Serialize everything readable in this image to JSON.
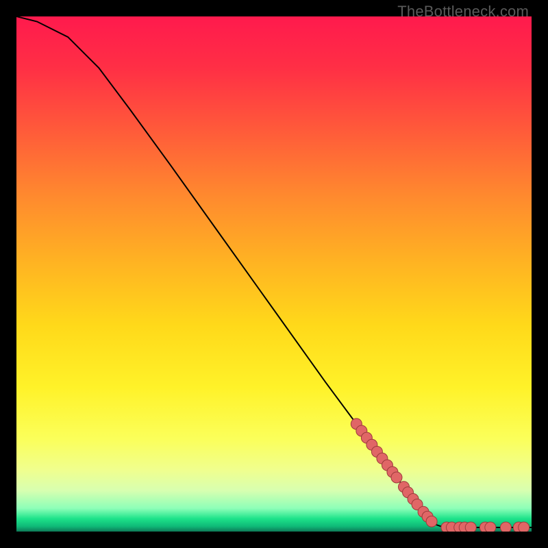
{
  "attribution": "TheBottleneck.com",
  "chart_data": {
    "type": "line",
    "title": "",
    "xlabel": "",
    "ylabel": "",
    "xlim": [
      0,
      100
    ],
    "ylim": [
      0,
      100
    ],
    "curve": [
      {
        "x": 0,
        "y": 100
      },
      {
        "x": 4,
        "y": 99
      },
      {
        "x": 10,
        "y": 96
      },
      {
        "x": 16,
        "y": 90
      },
      {
        "x": 22,
        "y": 82
      },
      {
        "x": 30,
        "y": 71
      },
      {
        "x": 40,
        "y": 57
      },
      {
        "x": 50,
        "y": 43
      },
      {
        "x": 60,
        "y": 29
      },
      {
        "x": 70,
        "y": 15.5
      },
      {
        "x": 78,
        "y": 5
      },
      {
        "x": 81,
        "y": 1.5
      },
      {
        "x": 83,
        "y": 0.8
      },
      {
        "x": 100,
        "y": 0.8
      }
    ],
    "markers_on_curve": [
      {
        "x": 66,
        "y": 20.9
      },
      {
        "x": 67,
        "y": 19.55
      },
      {
        "x": 68,
        "y": 18.2
      },
      {
        "x": 69,
        "y": 16.85
      },
      {
        "x": 70,
        "y": 15.5
      },
      {
        "x": 71,
        "y": 14.19
      },
      {
        "x": 72,
        "y": 12.88
      },
      {
        "x": 73,
        "y": 11.56
      },
      {
        "x": 73.8,
        "y": 10.51
      },
      {
        "x": 75.2,
        "y": 8.68
      },
      {
        "x": 76,
        "y": 7.62
      },
      {
        "x": 77,
        "y": 6.31
      },
      {
        "x": 77.8,
        "y": 5.26
      },
      {
        "x": 79,
        "y": 3.83
      },
      {
        "x": 79.8,
        "y": 2.9
      },
      {
        "x": 80.6,
        "y": 1.97
      }
    ],
    "markers_flat": [
      {
        "x": 83.5,
        "y": 0.8
      },
      {
        "x": 84.5,
        "y": 0.8
      },
      {
        "x": 86,
        "y": 0.8
      },
      {
        "x": 87,
        "y": 0.8
      },
      {
        "x": 88.2,
        "y": 0.8
      },
      {
        "x": 91,
        "y": 0.8
      },
      {
        "x": 92,
        "y": 0.8
      },
      {
        "x": 95,
        "y": 0.8
      },
      {
        "x": 97.5,
        "y": 0.8
      },
      {
        "x": 98.5,
        "y": 0.8
      }
    ],
    "gradient_stops": [
      {
        "offset": 0.0,
        "color": "#ff1a4d"
      },
      {
        "offset": 0.1,
        "color": "#ff2f45"
      },
      {
        "offset": 0.22,
        "color": "#ff5a3a"
      },
      {
        "offset": 0.35,
        "color": "#ff8a2e"
      },
      {
        "offset": 0.48,
        "color": "#ffb422"
      },
      {
        "offset": 0.6,
        "color": "#ffd91a"
      },
      {
        "offset": 0.72,
        "color": "#fff229"
      },
      {
        "offset": 0.82,
        "color": "#fbff5a"
      },
      {
        "offset": 0.88,
        "color": "#f0ff8e"
      },
      {
        "offset": 0.92,
        "color": "#d8ffb0"
      },
      {
        "offset": 0.955,
        "color": "#8dffb8"
      },
      {
        "offset": 0.975,
        "color": "#1de38a"
      },
      {
        "offset": 0.99,
        "color": "#0fb877"
      },
      {
        "offset": 1.0,
        "color": "#0e7a58"
      }
    ],
    "marker_style": {
      "radius": 8,
      "fill": "#e06666",
      "stroke": "#9c3a3a",
      "stroke_width": 1
    },
    "line_style": {
      "stroke": "#000000",
      "width": 2
    }
  }
}
